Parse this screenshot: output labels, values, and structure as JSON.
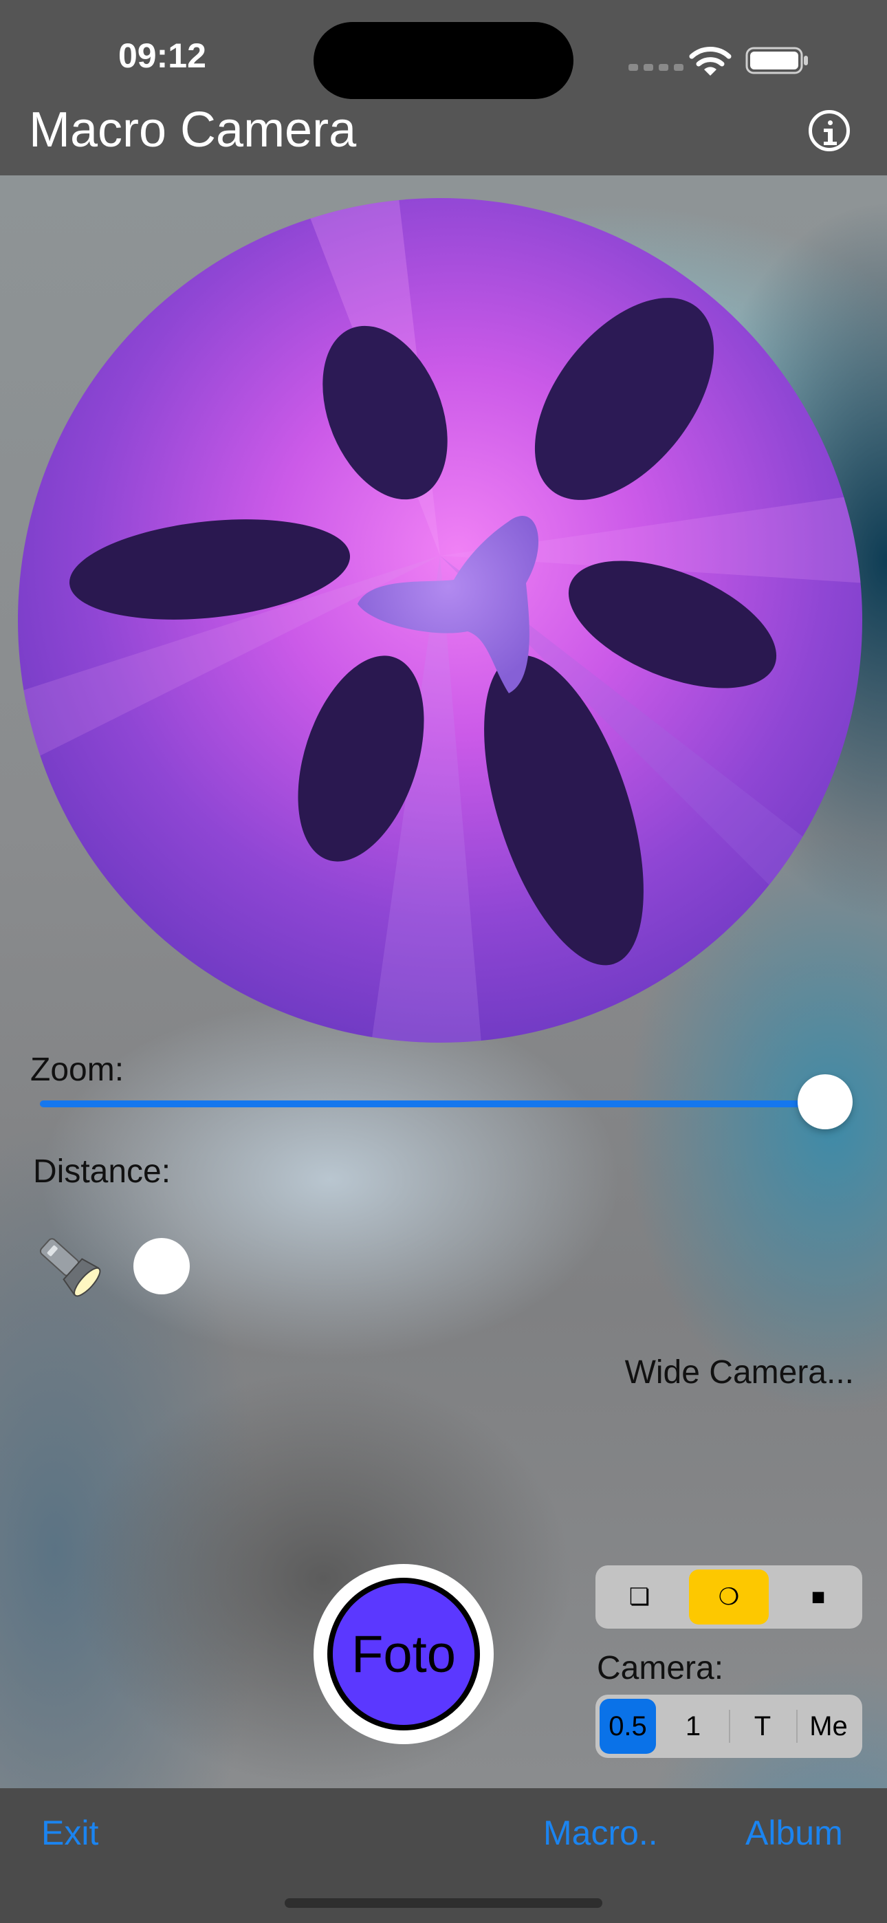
{
  "status_bar": {
    "time": "09:12"
  },
  "nav": {
    "title": "Macro Camera",
    "info_icon": "info-circle-icon"
  },
  "controls": {
    "zoom_label": "Zoom:",
    "zoom_value": 1.0,
    "distance_label": "Distance:",
    "torch_icon": "flashlight-icon",
    "camera_status": "Wide Camera..."
  },
  "shutter": {
    "label": "Foto",
    "color": "#5b38ff"
  },
  "shape_selector": {
    "options": [
      "❏",
      "❍",
      "■"
    ],
    "selected_index": 1,
    "selected_color": "#fdc800"
  },
  "camera_selector": {
    "label": "Camera:",
    "options": [
      "0.5",
      "1",
      "T",
      "Me"
    ],
    "selected_index": 0,
    "selected_color": "#0a72e8"
  },
  "tab_bar": {
    "exit": "Exit",
    "macro": "Macro..",
    "album": "Album",
    "link_color": "#1b84f0"
  }
}
